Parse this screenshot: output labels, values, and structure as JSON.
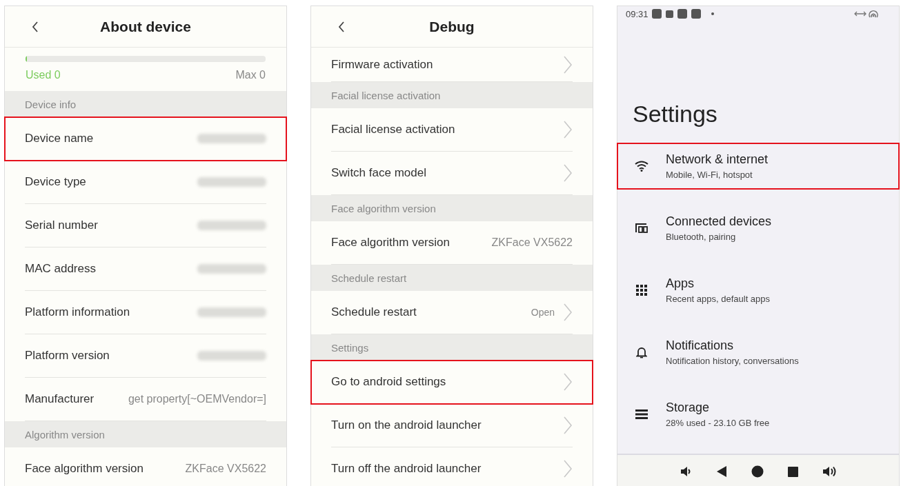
{
  "about_device": {
    "title": "About device",
    "capacity": {
      "level": 0,
      "used": "Used 0",
      "max": "Max 0"
    },
    "rows": [
      {
        "kind": "section",
        "label": "Device info"
      },
      {
        "kind": "info",
        "label": "Device name",
        "blurred": true,
        "highlighted": true
      },
      {
        "kind": "info",
        "label": "Device type",
        "blurred": true,
        "highlighted": false
      },
      {
        "kind": "info",
        "label": "Serial number",
        "blurred": true,
        "highlighted": false
      },
      {
        "kind": "info",
        "label": "MAC address",
        "blurred": true,
        "highlighted": false
      },
      {
        "kind": "info",
        "label": "Platform information",
        "blurred": true,
        "highlighted": false
      },
      {
        "kind": "info",
        "label": "Platform version",
        "blurred": true,
        "highlighted": false
      },
      {
        "kind": "info",
        "label": "Manufacturer",
        "value": "get property[~OEMVendor=]",
        "blurred": false,
        "highlighted": false
      },
      {
        "kind": "section",
        "label": "Algorithm version"
      },
      {
        "kind": "info",
        "label": "Face algorithm version",
        "value": "ZKFace VX5622",
        "blurred": false,
        "highlighted": false
      }
    ]
  },
  "debug": {
    "title": "Debug",
    "rows": [
      {
        "kind": "nav",
        "label": "Firmware activation",
        "highlighted": false
      },
      {
        "kind": "section",
        "label": "Facial license activation"
      },
      {
        "kind": "nav",
        "label": "Facial license activation",
        "highlighted": false
      },
      {
        "kind": "nav",
        "label": "Switch face model",
        "highlighted": false
      },
      {
        "kind": "section",
        "label": "Face algorithm version"
      },
      {
        "kind": "info",
        "label": "Face algorithm version",
        "value": "ZKFace VX5622",
        "highlighted": false
      },
      {
        "kind": "section",
        "label": "Schedule restart"
      },
      {
        "kind": "nav",
        "label": "Schedule restart",
        "value": "Open",
        "highlighted": false
      },
      {
        "kind": "section",
        "label": "Settings"
      },
      {
        "kind": "nav",
        "label": "Go to android settings",
        "highlighted": true
      },
      {
        "kind": "nav",
        "label": "Turn on the android launcher",
        "highlighted": false
      },
      {
        "kind": "nav",
        "label": "Turn off the android launcher",
        "highlighted": false
      }
    ]
  },
  "settings": {
    "time": "09:31",
    "title": "Settings",
    "items": [
      {
        "kind": "wifi",
        "title": "Network & internet",
        "subtitle": "Mobile, Wi-Fi, hotspot",
        "highlighted": true
      },
      {
        "kind": "devices",
        "title": "Connected devices",
        "subtitle": "Bluetooth, pairing",
        "highlighted": false
      },
      {
        "kind": "apps",
        "title": "Apps",
        "subtitle": "Recent apps, default apps",
        "highlighted": false
      },
      {
        "kind": "bell",
        "title": "Notifications",
        "subtitle": "Notification history, conversations",
        "highlighted": false
      },
      {
        "kind": "storage",
        "title": "Storage",
        "subtitle": "28% used - 23.10 GB free",
        "highlighted": false
      }
    ]
  }
}
